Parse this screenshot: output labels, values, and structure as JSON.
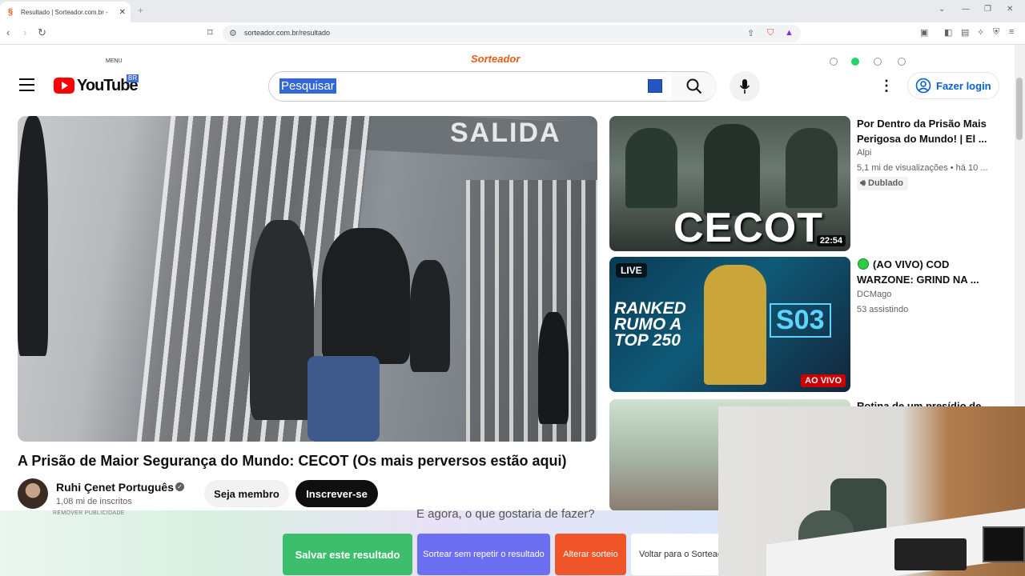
{
  "browser": {
    "tab_title": "Resultado | Sorteador.com.br - ",
    "tab_close": "✕",
    "new_tab": "+",
    "url": "sorteador.com.br/resultado"
  },
  "sorteador": {
    "menu_label": "MENU",
    "logo_text": "Sorteador"
  },
  "youtube": {
    "logo_text": "YouTube",
    "country_code": "BR",
    "search_value": "Pesquisar",
    "login_label": "Fazer login"
  },
  "video": {
    "sign_text": "SALIDA",
    "title": "A Prisão de Maior Segurança do Mundo: CECOT (Os mais perversos estão aqui)",
    "channel_name": "Ruhi Çenet Português",
    "subscribers": "1,08 mi de inscritos",
    "member_label": "Seja membro",
    "subscribe_label": "Inscrever-se"
  },
  "sidebar": {
    "items": [
      {
        "thumb_text": "CECOT",
        "duration": "22:54",
        "title": "Por Dentro da Prisão Mais Perigosa do Mundo! | El ...",
        "channel": "Alpi",
        "meta": "5,1 mi de visualizações • há 10 ...",
        "badge": "Dublado"
      },
      {
        "live_badge": "LIVE",
        "thumb_text": "RANKED RUMO A TOP 250",
        "thumb_logo": "S03",
        "aovivo_badge": "AO VIVO",
        "title": "(AO VIVO) COD WARZONE: GRIND NA ...",
        "channel": "DCMago",
        "meta": "53 assistindo"
      },
      {
        "title": "Rotina de um presídio de"
      }
    ]
  },
  "bottom": {
    "remove_ads": "REMOVER PUBLICIDADE",
    "question": "E agora, o que gostaria de fazer?",
    "save": "Salvar este resultado",
    "repeat": "Sortear sem repetir o resultado",
    "change": "Alterar sorteio",
    "back": "Voltar para o Sorteador"
  },
  "colors": {
    "yt_red": "#ff0000",
    "login_blue": "#065fd4",
    "save_green": "#3dbe6c",
    "repeat_purple": "#6c6ff2",
    "change_orange": "#f0552a"
  }
}
